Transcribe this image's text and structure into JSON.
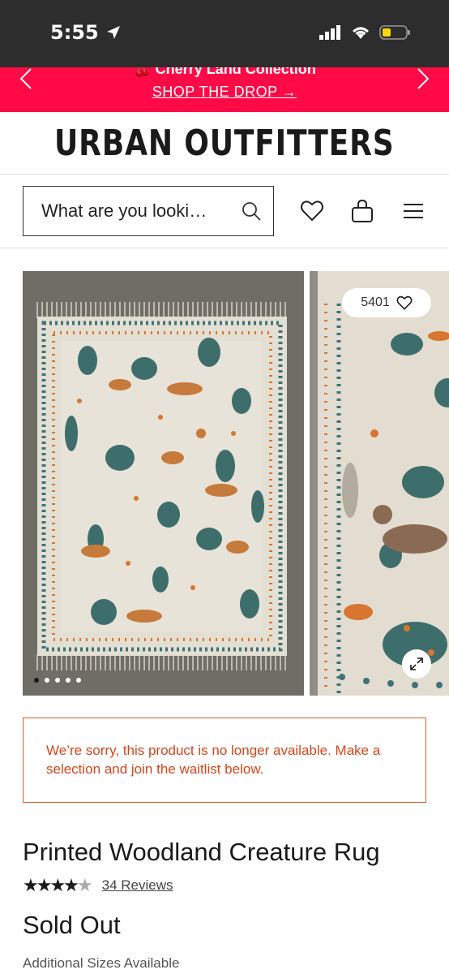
{
  "status": {
    "time": "5:55"
  },
  "promo": {
    "title": "🍒 Cherry Land Collection",
    "link": "SHOP THE DROP →"
  },
  "header": {
    "logo": "URBAN OUTFITTERS"
  },
  "search": {
    "placeholder": "What are you looki…"
  },
  "gallery": {
    "like_count": "5401",
    "image_count": 5,
    "active_index": 0
  },
  "alert": {
    "message": "We’re sorry, this product is no longer available. Make a selection and join the waitlist below."
  },
  "product": {
    "title": "Printed Woodland Creature Rug",
    "rating": 4,
    "rating_max": 5,
    "stars_on": "★★★★",
    "stars_off": "★",
    "reviews": "34 Reviews",
    "price": "Sold Out",
    "sizes_label": "Additional Sizes Available"
  },
  "colors": {
    "promo": "#ff0a47",
    "alert": "#d6461a",
    "status_bar": "#2d2d2d"
  }
}
